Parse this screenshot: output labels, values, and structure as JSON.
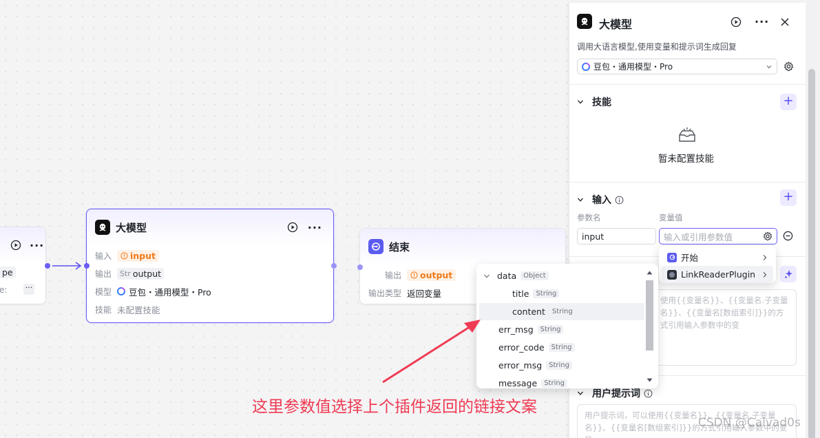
{
  "left_node": {
    "partial_tag": "pe",
    "partial_text": "e:"
  },
  "llm_node": {
    "title": "大模型",
    "input_label": "输入",
    "input_value": "input",
    "output_label": "输出",
    "output_type": "Str",
    "output_value": "output",
    "model_label": "模型",
    "model_value": "豆包・通用模型・Pro",
    "skill_label": "技能",
    "skill_value": "未配置技能"
  },
  "end_node": {
    "title": "结束",
    "output_label": "输出",
    "output_value": "output",
    "output_type_label": "输出类型",
    "output_type_value": "返回变量"
  },
  "panel": {
    "title": "大模型",
    "description": "调用大语言模型,使用变量和提示词生成回复",
    "model_select": "豆包・通用模型・Pro",
    "skills_title": "技能",
    "skills_empty": "暂未配置技能",
    "input_title": "输入",
    "col_param": "参数名",
    "col_value": "变量值",
    "param_name": "input",
    "value_placeholder": "输入或引用参数值",
    "system_prompt_hint": "使用{{变量名}}、{{变量名.子变量名}}、{{变量名[数组索引]}}的方式引用输入参数中的变",
    "user_prompt_title": "用户提示词",
    "user_prompt_hint": "用户提示词，可以使用{{变量名}}、{{变量名.子变量名}}、{{变量名[数组索引]}}的方式引用输入参数中的变量"
  },
  "cascader": {
    "items": [
      {
        "label": "开始"
      },
      {
        "label": "LinkReaderPlugin"
      }
    ]
  },
  "tree": {
    "rows": [
      {
        "name": "data",
        "type": "Object"
      },
      {
        "name": "title",
        "type": "String"
      },
      {
        "name": "content",
        "type": "String"
      },
      {
        "name": "err_msg",
        "type": "String"
      },
      {
        "name": "error_code",
        "type": "String"
      },
      {
        "name": "error_msg",
        "type": "String"
      },
      {
        "name": "message",
        "type": "String"
      }
    ]
  },
  "annotation": "这里参数值选择上个插件返回的链接文案",
  "watermark": "CSDN @Calvad0s",
  "colors": {
    "accent": "#6a5ef5",
    "orange": "#f07a1a",
    "annotation_red": "#ef3b53"
  }
}
